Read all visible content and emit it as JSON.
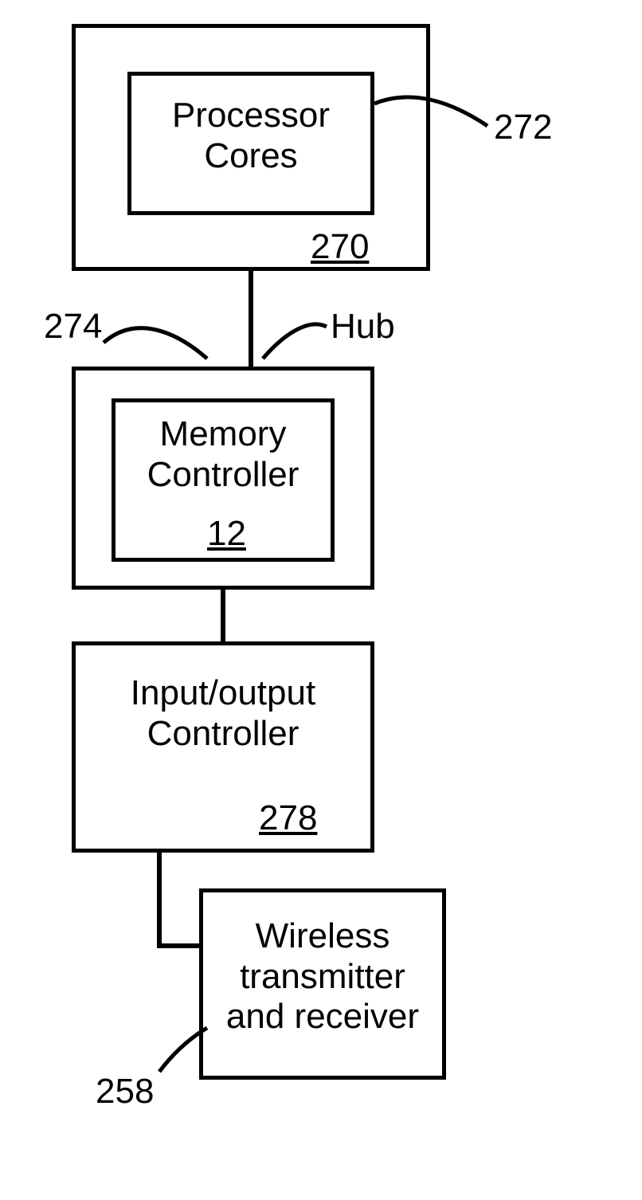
{
  "blocks": {
    "processor_outer_ref": "270",
    "processor_cores_label": "Processor\nCores",
    "processor_cores_ref": "272",
    "hub_outer_ref": "274",
    "hub_label": "Hub",
    "memory_controller_label": "Memory\nController",
    "memory_controller_ref": "12",
    "io_controller_label": "Input/output\nController",
    "io_controller_ref": "278",
    "wireless_label": "Wireless\ntransmitter\nand receiver",
    "wireless_ref": "258"
  }
}
